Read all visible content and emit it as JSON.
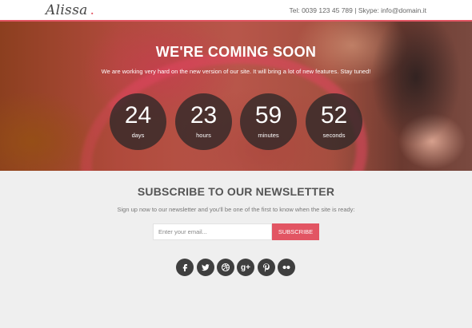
{
  "header": {
    "logo_text": "Alissa",
    "logo_dot": ".",
    "contact": "Tel: 0039 123 45 789 | Skype: info@domain.it"
  },
  "hero": {
    "title": "WE'RE COMING SOON",
    "subtitle": "We are working very hard on the new version of our site. It will bring a lot of new features. Stay tuned!",
    "countdown": [
      {
        "value": "24",
        "label": "days"
      },
      {
        "value": "23",
        "label": "hours"
      },
      {
        "value": "59",
        "label": "minutes"
      },
      {
        "value": "52",
        "label": "seconds"
      }
    ]
  },
  "newsletter": {
    "title": "SUBSCRIBE TO OUR NEWSLETTER",
    "subtitle": "Sign up now to our newsletter and you'll be one of the first to know when the site is ready:",
    "email_placeholder": "Enter your email...",
    "button_label": "SUBSCRIBE"
  },
  "social": {
    "icons": [
      "facebook-icon",
      "twitter-icon",
      "dribbble-icon",
      "google-plus-icon",
      "pinterest-icon",
      "flickr-icon"
    ],
    "google_plus_text": "g+"
  },
  "colors": {
    "accent": "#e25563",
    "social_bg": "#3f3f3f",
    "page_bg": "#efefef"
  }
}
